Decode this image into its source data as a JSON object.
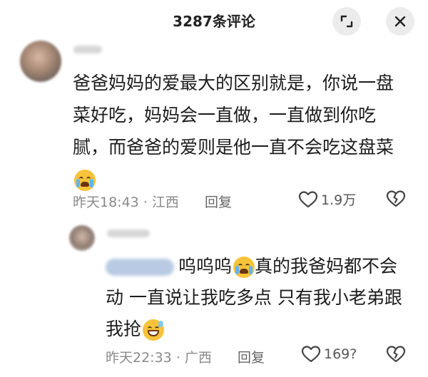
{
  "header": {
    "title": "3287条评论",
    "expand_icon": "expand-icon",
    "close_icon": "close-icon"
  },
  "comments": [
    {
      "lines": [
        "爸爸妈妈的爱最大的区别就是，你说一盘",
        "菜好吃，妈妈会一直做，一直做到你吃",
        "腻，而爸爸的爱则是他一直不会吃这盘菜"
      ],
      "emoji": "loudly-crying-face",
      "time_location": "昨天18:43 · 江西",
      "reply_label": "回复",
      "likes": "1.9万"
    }
  ],
  "reply": {
    "line1_a": "呜呜呜",
    "line1_b": "真的我爸妈都不会",
    "line2": "动 一直说让我吃多点 只有我小老弟跟",
    "line3": "我抢",
    "emoji1": "loudly-crying-face",
    "emoji2": "grinning-face-with-sweat",
    "time_location": "昨天22:33 · 广西",
    "reply_label": "回复",
    "likes": "169?"
  },
  "colors": {
    "text": "#1c1c1c",
    "meta": "#8a8a8a",
    "icon_bg": "#ececec"
  }
}
